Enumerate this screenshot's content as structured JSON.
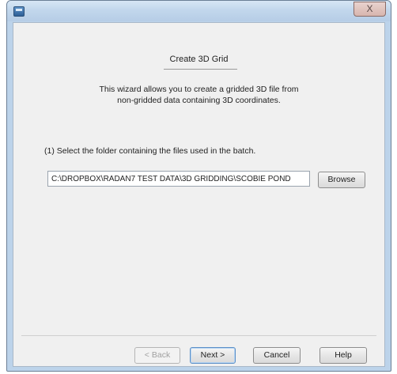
{
  "window": {
    "title": "",
    "close_label": "X"
  },
  "wizard": {
    "heading": "Create 3D Grid",
    "description_line1": "This wizard allows you to create a gridded 3D file from",
    "description_line2": "non-gridded data containing 3D coordinates.",
    "step_label": "(1) Select the folder containing the files used in the batch.",
    "folder_path": "C:\\DROPBOX\\RADAN7 TEST DATA\\3D GRIDDING\\SCOBIE POND",
    "browse_label": "Browse"
  },
  "footer": {
    "back_label": "< Back",
    "back_enabled": false,
    "next_label": "Next >",
    "cancel_label": "Cancel",
    "help_label": "Help"
  },
  "colors": {
    "frame": "#bcd3ea",
    "client_background": "#f0f0f0",
    "default_button_border": "#5b8fc7"
  }
}
